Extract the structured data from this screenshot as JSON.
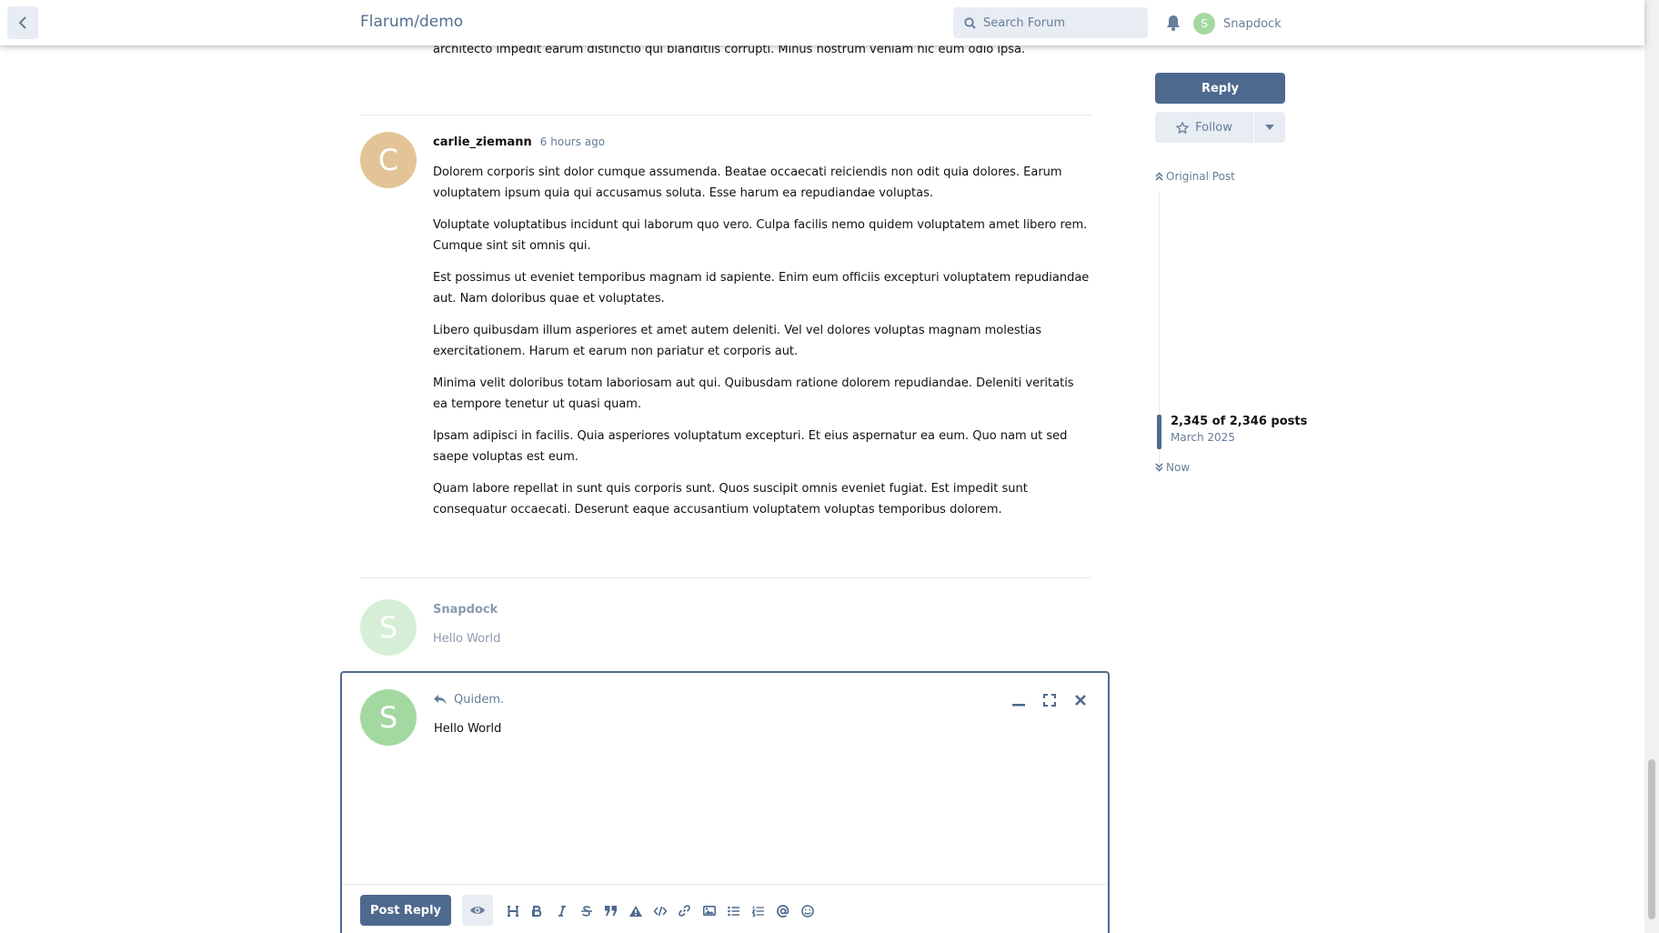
{
  "header": {
    "site_title": "Flarum/demo",
    "search_placeholder": "Search Forum",
    "user_initial": "S",
    "user_name": "Snapdock"
  },
  "posts": {
    "prev_tail": "architecto impedit earum distinctio qui blanditiis corrupti. Minus nostrum veniam hic eum odio ipsa.",
    "main": {
      "author": "carlie_ziemann",
      "initial": "C",
      "avatar_color": "#e3c496",
      "time": "6 hours ago",
      "paragraphs": [
        "Dolorem corporis sint dolor cumque assumenda. Beatae occaecati reiciendis non odit quia dolores. Earum voluptatem ipsum quia qui accusamus soluta. Esse harum ea repudiandae voluptas.",
        "Voluptate voluptatibus incidunt qui laborum quo vero. Culpa facilis nemo quidem voluptatem amet libero rem. Cumque sint sit omnis qui.",
        "Est possimus ut eveniet temporibus magnam id sapiente. Enim eum officiis excepturi voluptatem repudiandae aut. Nam doloribus quae et voluptates.",
        "Libero quibusdam illum asperiores et amet autem deleniti. Vel vel dolores voluptas magnam molestias exercitationem. Harum et earum non pariatur et corporis aut.",
        "Minima velit doloribus totam laboriosam aut qui. Quibusdam ratione dolorem repudiandae. Deleniti veritatis ea tempore tenetur ut quasi quam.",
        "Ipsam adipisci in facilis. Quia asperiores voluptatum excepturi. Et eius aspernatur ea eum. Quo nam ut sed saepe voluptas est eum.",
        "Quam labore repellat in sunt quis corporis sunt. Quos suscipit omnis eveniet fugiat. Est impedit sunt consequatur occaecati. Deserunt eaque accusantium voluptatem voluptas temporibus dolorem."
      ]
    },
    "preview": {
      "author": "Snapdock",
      "initial": "S",
      "avatar_color": "#d6eed5",
      "text": "Hello World"
    }
  },
  "composer": {
    "initial": "S",
    "reply_to": "Quidem.",
    "content": "Hello World",
    "post_reply_label": "Post Reply",
    "toolbar_icons": [
      "heading-icon",
      "bold-icon",
      "italic-icon",
      "strikethrough-icon",
      "quote-icon",
      "spoiler-icon",
      "code-icon",
      "link-icon",
      "image-icon",
      "bullet-list-icon",
      "numbered-list-icon",
      "mention-icon",
      "emoji-icon"
    ]
  },
  "sidebar": {
    "reply_label": "Reply",
    "follow_label": "Follow",
    "original_post_label": "Original Post",
    "scrubber_count": "2,345 of 2,346 posts",
    "scrubber_date": "March 2025",
    "now_label": "Now"
  },
  "colors": {
    "primary": "#4d698e",
    "muted": "#667d99",
    "control_bg": "#e8ecf3",
    "user_avatar": "#a4d8a1"
  }
}
